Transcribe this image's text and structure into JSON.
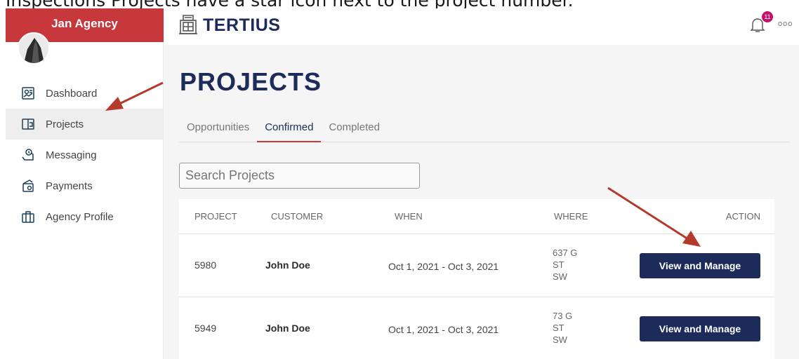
{
  "caption": "Inspections Projects have a star icon next to the project number.",
  "sidebar": {
    "agency_name": "Jan Agency",
    "items": [
      {
        "label": "Dashboard",
        "icon": "dashboard-icon"
      },
      {
        "label": "Projects",
        "icon": "projects-icon",
        "active": true
      },
      {
        "label": "Messaging",
        "icon": "messaging-icon"
      },
      {
        "label": "Payments",
        "icon": "payments-icon"
      },
      {
        "label": "Agency Profile",
        "icon": "agency-profile-icon"
      }
    ]
  },
  "header": {
    "logo_text": "TERTIUS",
    "notification_count": "11",
    "more_label": "ooo"
  },
  "main": {
    "title": "PROJECTS",
    "tabs": [
      {
        "label": "Opportunities",
        "active": false
      },
      {
        "label": "Confirmed",
        "active": true
      },
      {
        "label": "Completed",
        "active": false
      }
    ],
    "search": {
      "placeholder": "Search Projects"
    },
    "table": {
      "columns": [
        "PROJECT",
        "CUSTOMER",
        "WHEN",
        "WHERE",
        "ACTION"
      ],
      "rows": [
        {
          "project": "5980",
          "customer": "John Doe",
          "when": "Oct 1, 2021 - Oct 3, 2021",
          "where": [
            "637 G",
            "ST",
            "SW"
          ],
          "action": "View and Manage"
        },
        {
          "project": "5949",
          "customer": "John Doe",
          "when": "Oct 1, 2021 - Oct 3, 2021",
          "where": [
            "73 G",
            "ST",
            "SW"
          ],
          "action": "View and Manage"
        }
      ]
    }
  },
  "colors": {
    "brand_red": "#c7383c",
    "navy": "#1d2b5b",
    "badge": "#c4126b",
    "arrow": "#b33a2c"
  }
}
